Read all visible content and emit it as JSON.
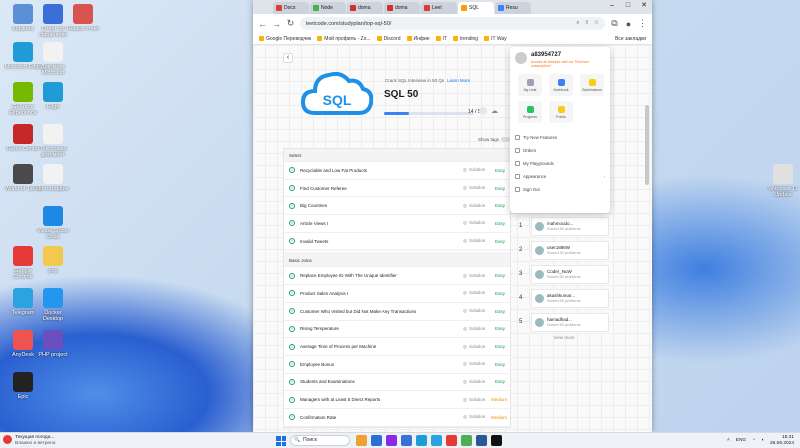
{
  "desktop": {
    "icons": [
      {
        "label": "Корзина",
        "color": "#5b8fd6"
      },
      {
        "label": "Отчет по сведениям",
        "color": "#3a6fd8"
      },
      {
        "label": "Новый отчёт",
        "color": "#d9534f"
      },
      {
        "label": "Microsoft Edge",
        "color": "#1f9cd8"
      },
      {
        "label": "Документ Microsoft",
        "color": "#f2f2f2"
      },
      {
        "label": "GeForce Experience",
        "color": "#76b900"
      },
      {
        "label": "Edge",
        "color": "#1f9cd8"
      },
      {
        "label": "Game Center",
        "color": "#c62828"
      },
      {
        "label": "Текстовый документ",
        "color": "#f2f2f2"
      },
      {
        "label": "World of Tanks",
        "color": "#4a4a4a"
      },
      {
        "label": "Фотографии",
        "color": "#f2f2f2"
      },
      {
        "label": "Visual Studio Code",
        "color": "#1e88e5"
      },
      {
        "label": "php",
        "color": "#f2c94c"
      },
      {
        "label": "Google Chrome",
        "color": "#e53935"
      },
      {
        "label": "Telegram",
        "color": "#2aa3e0"
      },
      {
        "label": "Docker Desktop",
        "color": "#2496ed"
      },
      {
        "label": "AnyDesk",
        "color": "#ef5350"
      },
      {
        "label": "PHP project",
        "color": "#6a4fbf"
      },
      {
        "label": "Epic",
        "color": "#222222"
      },
      {
        "label": "Windows 11 Update",
        "color": "#e0e0e0"
      }
    ]
  },
  "browser": {
    "tabs": [
      "Docs",
      "Node",
      "doma",
      "doma",
      "Leet",
      "SQL",
      "Resu"
    ],
    "active_tab": 5,
    "url": "leetcode.com/studyplan/top-sql-50/",
    "bookmarks": [
      "Google Переводчик",
      "Мой профиль - Zo...",
      "Discord",
      "Инфин",
      "IT",
      "trending",
      "IT Way"
    ],
    "all_bookmarks": "Все закладки"
  },
  "hero": {
    "meta": "Crack SQL Interview in 50 Qs",
    "learn_more": "Learn More",
    "title": "SQL 50",
    "progress_text": "14 / 50",
    "progress": 0.28,
    "show_tags": "Show tags"
  },
  "sections": [
    {
      "title": "Select",
      "rows": [
        {
          "title": "Recyclable and Low Fat Products",
          "solution": "Solution",
          "difficulty": "Easy"
        },
        {
          "title": "Find Customer Referee",
          "solution": "Solution",
          "difficulty": "Easy"
        },
        {
          "title": "Big Countries",
          "solution": "Solution",
          "difficulty": "Easy"
        },
        {
          "title": "Article Views I",
          "solution": "Solution",
          "difficulty": "Easy"
        },
        {
          "title": "Invalid Tweets",
          "solution": "Solution",
          "difficulty": "Easy"
        }
      ]
    },
    {
      "title": "Basic Joins",
      "rows": [
        {
          "title": "Replace Employee ID With The Unique Identifier",
          "solution": "Solution",
          "difficulty": "Easy"
        },
        {
          "title": "Product Sales Analysis I",
          "solution": "Solution",
          "difficulty": "Easy"
        },
        {
          "title": "Customer Who Visited but Did Not Make Any Transactions",
          "solution": "Solution",
          "difficulty": "Easy"
        },
        {
          "title": "Rising Temperature",
          "solution": "Solution",
          "difficulty": "Easy"
        },
        {
          "title": "Average Time of Process per Machine",
          "solution": "Solution",
          "difficulty": "Easy"
        },
        {
          "title": "Employee Bonus",
          "solution": "Solution",
          "difficulty": "Easy"
        },
        {
          "title": "Students and Examinations",
          "solution": "Solution",
          "difficulty": "Easy"
        },
        {
          "title": "Managers with at Least 5 Direct Reports",
          "solution": "Solution",
          "difficulty": "Medium"
        },
        {
          "title": "Confirmation Rate",
          "solution": "Solution",
          "difficulty": "Medium"
        }
      ]
    }
  ],
  "leaderboard": {
    "rows": [
      {
        "rank": "1",
        "name": "mahmoudo...",
        "sub": "Solved 50 problems"
      },
      {
        "rank": "2",
        "name": "user1886W",
        "sub": "Solved 50 problems"
      },
      {
        "rank": "3",
        "name": "Coder_NuW",
        "sub": "Solved 50 problems"
      },
      {
        "rank": "4",
        "name": "akashkumar...",
        "sub": "Solved 50 problems"
      },
      {
        "rank": "5",
        "name": "hamadhad...",
        "sub": "Solved 50 problems"
      }
    ],
    "view_more": "View more"
  },
  "dropdown": {
    "username": "a83954727",
    "note": "Access all features with our Premium subscription!",
    "tiles": [
      {
        "label": "My Lists",
        "color": "#9ca3af"
      },
      {
        "label": "Notebook",
        "color": "#3b82f6"
      },
      {
        "label": "Submissions",
        "color": "#facc15"
      },
      {
        "label": "Progress",
        "color": "#22c55e"
      },
      {
        "label": "Points",
        "color": "#facc15"
      }
    ],
    "items": [
      "Try New Features",
      "Orders",
      "My Playgrounds",
      "Appearance",
      "Sign Out"
    ]
  },
  "taskbar": {
    "weather_title": "Текущая погода...",
    "weather_sub": "Влажно и ветрено",
    "search": "Поиск",
    "lang": "ENG",
    "time": "15:31",
    "date": "26.06.2024",
    "apps": [
      "#f0a030",
      "#2a6fd6",
      "#8a2be2",
      "#3a6fd8",
      "#1f9cd8",
      "#2aa3e0",
      "#e53935",
      "#4caf50",
      "#2b5797",
      "#111111"
    ]
  }
}
